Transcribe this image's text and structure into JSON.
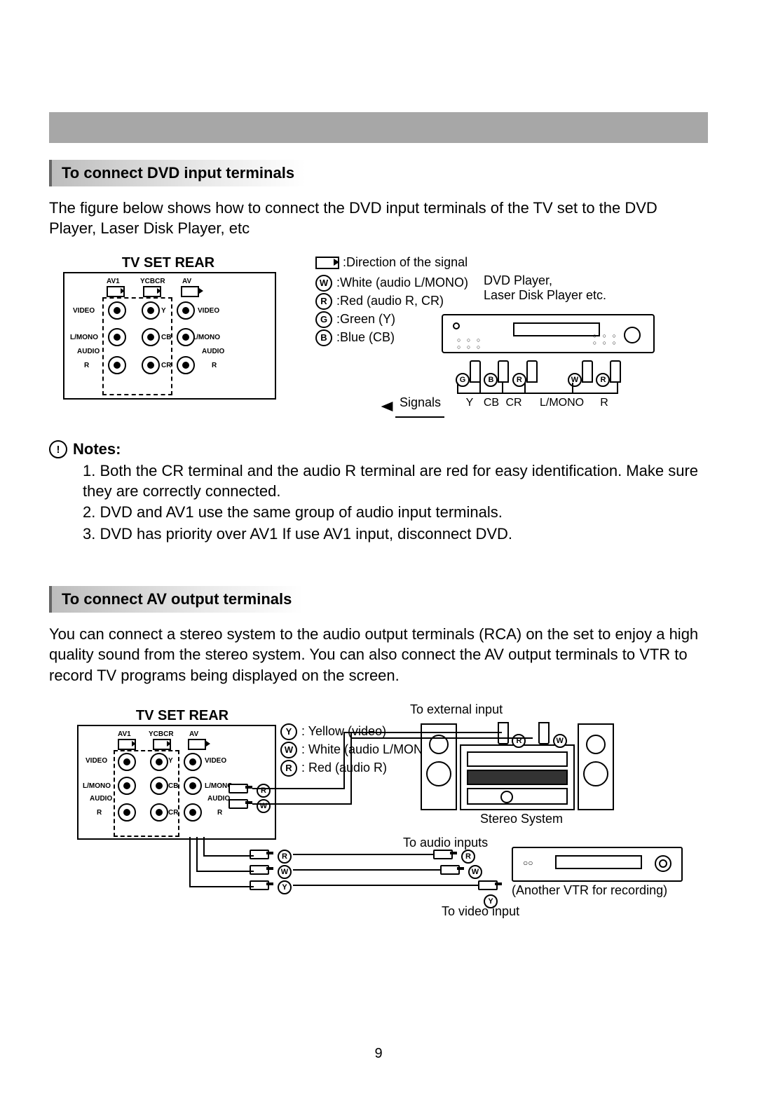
{
  "sections": {
    "dvd_heading": "To connect DVD input terminals",
    "av_heading": "To connect AV output terminals"
  },
  "dvd_intro": "The figure below shows how to connect the DVD input terminals of the TV set to the DVD Player, Laser Disk Player, etc",
  "diagram1": {
    "tv_rear_title": "TV SET REAR",
    "col_headers": {
      "av1": "AV1",
      "yc": "YCBCR",
      "av_out": "AV"
    },
    "row_labels": {
      "video": "VIDEO",
      "lmono": "L/MONO",
      "audio": "AUDIO",
      "r": "R"
    },
    "yc_labels": {
      "y": "Y",
      "cb": "CB",
      "cr": "CR"
    },
    "legend_title": ":Direction of the signal",
    "legend": {
      "w": ":White (audio L/MONO)",
      "r": ":Red (audio R, CR)",
      "g": ":Green (Y)",
      "b": ":Blue (CB)"
    },
    "legend_icons": {
      "w": "W",
      "r": "R",
      "g": "G",
      "b": "B"
    },
    "device_label": "DVD Player,\nLaser Disk Player etc.",
    "signals": "Signals",
    "signal_labels": [
      "Y",
      "CB",
      "CR",
      "L/MONO",
      "R"
    ]
  },
  "notes": {
    "title": "Notes:",
    "items": [
      "1. Both the CR terminal and the audio R terminal are red for easy identification. Make sure they are correctly connected.",
      "2. DVD and AV1 use the same group of audio input terminals.",
      "3. DVD has priority over AV1 If use AV1 input, disconnect DVD."
    ]
  },
  "av_intro": "You can connect a stereo system to the audio output terminals (RCA) on the set to enjoy a high quality sound from the stereo system. You can also connect the AV output terminals to VTR to record TV programs being displayed on the screen.",
  "diagram2": {
    "tv_rear_title": "TV SET REAR",
    "col_headers": {
      "av1": "AV1",
      "yc": "YCBCR",
      "av_out": "AV"
    },
    "row_labels": {
      "video": "VIDEO",
      "lmono": "L/MONO",
      "audio": "AUDIO",
      "r": "R"
    },
    "yc_labels": {
      "y": "Y",
      "cb": "CB",
      "cr": "CR"
    },
    "color_key": {
      "y": ": Yellow (video)",
      "w": ": White (audio L/MONO)",
      "r": ": Red (audio R)"
    },
    "color_icons": {
      "y": "Y",
      "w": "W",
      "r": "R"
    },
    "to_external": "To external input",
    "stereo": "Stereo System",
    "to_audio": "To audio inputs",
    "to_video": "To video input",
    "vtr_label": "(Another VTR for recording)",
    "plug_set1": [
      "R",
      "W"
    ],
    "plug_set2": [
      "R",
      "W",
      "Y"
    ],
    "stereo_plugs": [
      "R",
      "W"
    ],
    "vtr_plugs_audio": [
      "R",
      "W"
    ],
    "vtr_plug_video": "Y"
  },
  "page_number": "9"
}
